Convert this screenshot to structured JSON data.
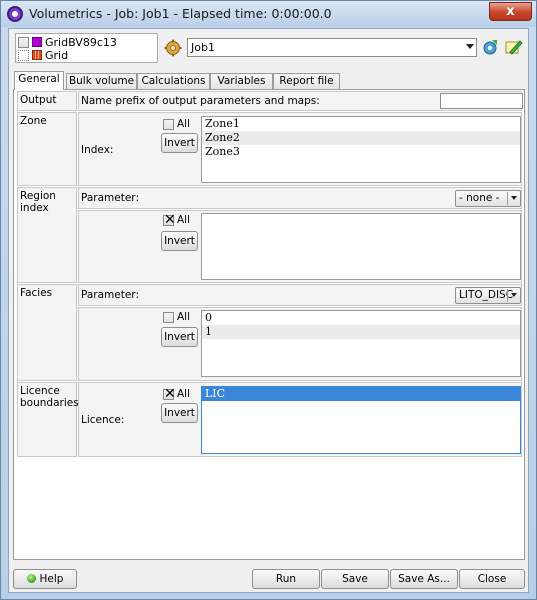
{
  "window": {
    "title": "Volumetrics - Job: Job1 - Elapsed time: 0:00:00.0",
    "close_glyph": "x"
  },
  "grids": [
    {
      "label": "GridBV89c13",
      "color": "#b000d0"
    },
    {
      "label": "Grid",
      "color": "#e24a1b"
    }
  ],
  "job": {
    "selected": "Job1"
  },
  "tabs": [
    "General",
    "Bulk volume",
    "Calculations",
    "Variables",
    "Report file"
  ],
  "active_tab": "General",
  "output": {
    "label": "Output",
    "prefix_label": "Name prefix of output parameters and maps:",
    "prefix_value": ""
  },
  "zone": {
    "label": "Zone",
    "all_label": "All",
    "invert_label": "Invert",
    "index_label": "Index:",
    "items": [
      "Zone1",
      "Zone2",
      "Zone3"
    ]
  },
  "region": {
    "label": "Region index",
    "param_label": "Parameter:",
    "param_value": "- none -",
    "all_label": "All",
    "invert_label": "Invert",
    "all_checked_glyph": "✕"
  },
  "facies": {
    "label": "Facies",
    "param_label": "Parameter:",
    "param_value": "LITO_DISC",
    "all_label": "All",
    "invert_label": "Invert",
    "items": [
      "0",
      "1"
    ]
  },
  "licence": {
    "label_line1": "Licence",
    "label_line2": "boundaries",
    "licence_label": "Licence:",
    "all_label": "All",
    "invert_label": "Invert",
    "all_checked_glyph": "✕",
    "items": [
      "LIC"
    ]
  },
  "footer": {
    "help": "Help",
    "run": "Run",
    "save": "Save",
    "save_as": "Save As...",
    "close": "Close"
  },
  "colors": {
    "selection": "#3a86d8",
    "accent_green": "#36a40e"
  }
}
